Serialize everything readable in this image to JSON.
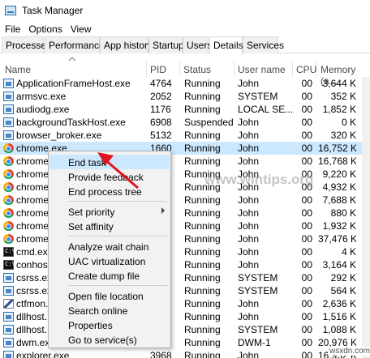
{
  "window": {
    "title": "Task Manager",
    "icon": "task-manager-icon"
  },
  "menu": [
    "File",
    "Options",
    "View"
  ],
  "tabs": [
    {
      "label": "Processes",
      "active": false
    },
    {
      "label": "Performance",
      "active": false
    },
    {
      "label": "App history",
      "active": false
    },
    {
      "label": "Startup",
      "active": false
    },
    {
      "label": "Users",
      "active": false
    },
    {
      "label": "Details",
      "active": true
    },
    {
      "label": "Services",
      "active": false
    }
  ],
  "columns": {
    "name": "Name",
    "pid": "PID",
    "status": "Status",
    "user": "User name",
    "cpu": "CPU",
    "memory": "Memory (a..."
  },
  "rows": [
    {
      "icon": "app-window-icon",
      "name": "ApplicationFrameHost.exe",
      "pid": "4764",
      "status": "Running",
      "user": "John",
      "cpu": "00",
      "memory": "3,644 K"
    },
    {
      "icon": "app-window-icon",
      "name": "armsvc.exe",
      "pid": "2052",
      "status": "Running",
      "user": "SYSTEM",
      "cpu": "00",
      "memory": "352 K"
    },
    {
      "icon": "app-window-icon",
      "name": "audiodg.exe",
      "pid": "1176",
      "status": "Running",
      "user": "LOCAL SE...",
      "cpu": "00",
      "memory": "1,852 K"
    },
    {
      "icon": "app-window-icon",
      "name": "backgroundTaskHost.exe",
      "pid": "6908",
      "status": "Suspended",
      "user": "John",
      "cpu": "00",
      "memory": "0 K"
    },
    {
      "icon": "app-window-icon",
      "name": "browser_broker.exe",
      "pid": "5132",
      "status": "Running",
      "user": "John",
      "cpu": "00",
      "memory": "320 K"
    },
    {
      "icon": "chrome-icon",
      "name": "chrome.exe",
      "pid": "1660",
      "status": "Running",
      "user": "John",
      "cpu": "00",
      "memory": "16,752 K",
      "selected": true
    },
    {
      "icon": "chrome-icon",
      "name": "chrome",
      "pid": "",
      "status": "Running",
      "user": "John",
      "cpu": "00",
      "memory": "16,768 K"
    },
    {
      "icon": "chrome-icon",
      "name": "chrome",
      "pid": "",
      "status": "Running",
      "user": "John",
      "cpu": "00",
      "memory": "9,220 K"
    },
    {
      "icon": "chrome-icon",
      "name": "chrome",
      "pid": "",
      "status": "Running",
      "user": "John",
      "cpu": "00",
      "memory": "4,932 K"
    },
    {
      "icon": "chrome-icon",
      "name": "chrome",
      "pid": "",
      "status": "Running",
      "user": "John",
      "cpu": "00",
      "memory": "7,688 K"
    },
    {
      "icon": "chrome-icon",
      "name": "chrome",
      "pid": "",
      "status": "Running",
      "user": "John",
      "cpu": "00",
      "memory": "880 K"
    },
    {
      "icon": "chrome-icon",
      "name": "chrome",
      "pid": "",
      "status": "Running",
      "user": "John",
      "cpu": "00",
      "memory": "1,932 K"
    },
    {
      "icon": "chrome-icon",
      "name": "chrome",
      "pid": "",
      "status": "Running",
      "user": "John",
      "cpu": "00",
      "memory": "37,476 K"
    },
    {
      "icon": "cmd-icon",
      "name": "cmd.exe",
      "pid": "",
      "status": "Running",
      "user": "John",
      "cpu": "00",
      "memory": "4 K"
    },
    {
      "icon": "cmd-icon",
      "name": "conhost",
      "pid": "",
      "status": "Running",
      "user": "John",
      "cpu": "00",
      "memory": "3,164 K"
    },
    {
      "icon": "app-window-icon",
      "name": "csrss.ex",
      "pid": "",
      "status": "Running",
      "user": "SYSTEM",
      "cpu": "00",
      "memory": "292 K"
    },
    {
      "icon": "app-window-icon",
      "name": "csrss.ex",
      "pid": "",
      "status": "Running",
      "user": "SYSTEM",
      "cpu": "00",
      "memory": "564 K"
    },
    {
      "icon": "pen-icon",
      "name": "ctfmon.",
      "pid": "",
      "status": "Running",
      "user": "John",
      "cpu": "00",
      "memory": "2,636 K"
    },
    {
      "icon": "app-window-icon",
      "name": "dllhost.",
      "pid": "",
      "status": "Running",
      "user": "John",
      "cpu": "00",
      "memory": "1,516 K"
    },
    {
      "icon": "app-window-icon",
      "name": "dllhost.",
      "pid": "",
      "status": "Running",
      "user": "SYSTEM",
      "cpu": "00",
      "memory": "1,088 K"
    },
    {
      "icon": "app-window-icon",
      "name": "dwm.ex",
      "pid": "",
      "status": "Running",
      "user": "DWM-1",
      "cpu": "00",
      "memory": "20,976 K"
    },
    {
      "icon": "app-window-icon",
      "name": "explorer.exe",
      "pid": "3968",
      "status": "Running",
      "user": "John",
      "cpu": "00",
      "memory": "16,952 K"
    }
  ],
  "context_menu": {
    "groups": [
      [
        "End task",
        "Provide feedback",
        "End process tree"
      ],
      [
        "Set priority",
        "Set affinity"
      ],
      [
        "Analyze wait chain",
        "UAC virtualization",
        "Create dump file"
      ],
      [
        "Open file location",
        "Search online",
        "Properties",
        "Go to service(s)"
      ]
    ],
    "highlighted": "End task",
    "submenu_item": "Set priority"
  },
  "watermark": "www.wintips.org",
  "footer_watermark": "wsxdn.com",
  "colors": {
    "selection": "#cce8ff",
    "arrow": "#e0141e"
  }
}
